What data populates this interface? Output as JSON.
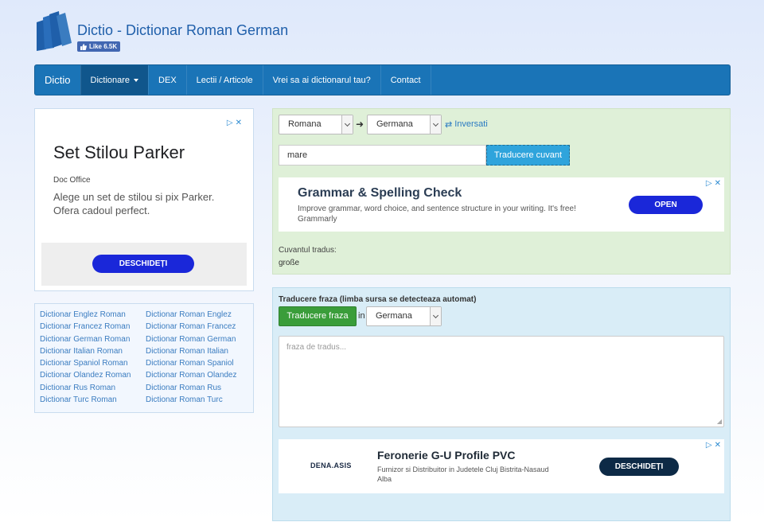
{
  "header": {
    "site_title": "Dictio - Dictionar Roman German",
    "fb_like": "Like 6.5K"
  },
  "navbar": {
    "brand": "Dictio",
    "items": [
      {
        "label": "Dictionare"
      },
      {
        "label": "DEX"
      },
      {
        "label": "Lectii / Articole"
      },
      {
        "label": "Vrei sa ai dictionarul tau?"
      },
      {
        "label": "Contact"
      }
    ]
  },
  "left_ad": {
    "headline": "Set Stilou Parker",
    "source": "Doc Office",
    "description": "Alege un set de stilou si pix Parker. Ofera cadoul perfect.",
    "cta": "DESCHIDEȚI"
  },
  "dictionary_links": [
    [
      "Dictionar Englez Roman",
      "Dictionar Roman Englez"
    ],
    [
      "Dictionar Francez Roman",
      "Dictionar Roman Francez"
    ],
    [
      "Dictionar German Roman",
      "Dictionar Roman German"
    ],
    [
      "Dictionar Italian Roman",
      "Dictionar Roman Italian"
    ],
    [
      "Dictionar Spaniol Roman",
      "Dictionar Roman Spaniol"
    ],
    [
      "Dictionar Olandez Roman",
      "Dictionar Roman Olandez"
    ],
    [
      "Dictionar Rus Roman",
      "Dictionar Roman Rus"
    ],
    [
      "Dictionar Turc Roman",
      "Dictionar Roman Turc"
    ]
  ],
  "translator": {
    "source_lang": "Romana",
    "target_lang": "Germana",
    "swap_label": "Inversati",
    "word_value": "mare",
    "translate_word_button": "Traducere cuvant",
    "ad": {
      "title": "Grammar & Spelling Check",
      "description": "Improve grammar, word choice, and sentence structure in your writing. It's free!",
      "brand": "Grammarly",
      "cta": "OPEN"
    },
    "result_label": "Cuvantul tradus:",
    "result_value": "große"
  },
  "phrase": {
    "title": "Traducere fraza (limba sursa se detecteaza automat)",
    "translate_button": "Traducere fraza",
    "in_label": "in",
    "target_lang": "Germana",
    "placeholder": "fraza de tradus...",
    "ad": {
      "logo": "DENA.ASIS",
      "title": "Feronerie G-U Profile PVC",
      "description": "Furnizor si Distribuitor in Judetele Cluj Bistrita-Nasaud Alba",
      "cta": "DESCHIDEȚI"
    }
  },
  "colors": {
    "navbar": "#1a74b7",
    "translate_panel": "#dff0d8",
    "phrase_panel": "#d9edf7",
    "phrase_button": "#3a9d3a",
    "word_button": "#2fa4dc"
  }
}
